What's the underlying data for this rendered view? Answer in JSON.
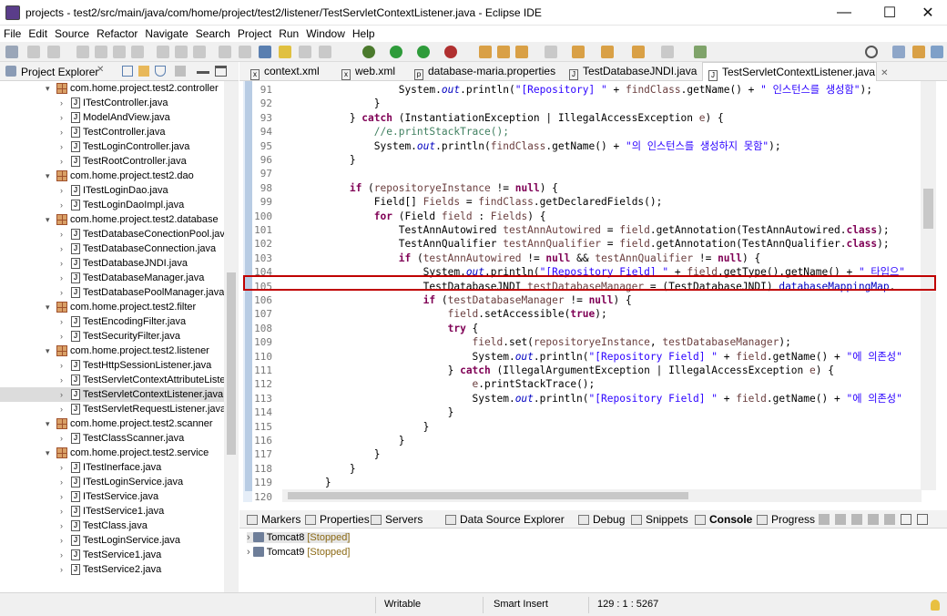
{
  "window": {
    "title": "projects - test2/src/main/java/com/home/project/test2/listener/TestServletContextListener.java - Eclipse IDE",
    "minimize": "—",
    "maximize": "☐",
    "close": "✕"
  },
  "menu": [
    "File",
    "Edit",
    "Source",
    "Refactor",
    "Navigate",
    "Search",
    "Project",
    "Run",
    "Window",
    "Help"
  ],
  "project_explorer": {
    "title": "Project Explorer",
    "items": [
      {
        "type": "pkg",
        "label": "com.home.project.test2.controller"
      },
      {
        "type": "file",
        "label": "ITestController.java"
      },
      {
        "type": "file",
        "label": "ModelAndView.java"
      },
      {
        "type": "file",
        "label": "TestController.java"
      },
      {
        "type": "file",
        "label": "TestLoginController.java"
      },
      {
        "type": "file",
        "label": "TestRootController.java"
      },
      {
        "type": "pkg",
        "label": "com.home.project.test2.dao"
      },
      {
        "type": "file",
        "label": "ITestLoginDao.java"
      },
      {
        "type": "file",
        "label": "TestLoginDaoImpl.java"
      },
      {
        "type": "pkg",
        "label": "com.home.project.test2.database"
      },
      {
        "type": "file",
        "label": "TestDatabaseConectionPool.java"
      },
      {
        "type": "file",
        "label": "TestDatabaseConnection.java"
      },
      {
        "type": "file",
        "label": "TestDatabaseJNDI.java"
      },
      {
        "type": "file",
        "label": "TestDatabaseManager.java"
      },
      {
        "type": "file",
        "label": "TestDatabasePoolManager.java"
      },
      {
        "type": "pkg",
        "label": "com.home.project.test2.filter"
      },
      {
        "type": "file",
        "label": "TestEncodingFilter.java"
      },
      {
        "type": "file",
        "label": "TestSecurityFilter.java"
      },
      {
        "type": "pkg",
        "label": "com.home.project.test2.listener"
      },
      {
        "type": "file",
        "label": "TestHttpSessionListener.java"
      },
      {
        "type": "file",
        "label": "TestServletContextAttributeListe"
      },
      {
        "type": "file",
        "label": "TestServletContextListener.java",
        "selected": true
      },
      {
        "type": "file",
        "label": "TestServletRequestListener.java"
      },
      {
        "type": "pkg",
        "label": "com.home.project.test2.scanner"
      },
      {
        "type": "file",
        "label": "TestClassScanner.java"
      },
      {
        "type": "pkg",
        "label": "com.home.project.test2.service"
      },
      {
        "type": "file",
        "label": "ITestInerface.java"
      },
      {
        "type": "file",
        "label": "ITestLoginService.java"
      },
      {
        "type": "file",
        "label": "ITestService.java"
      },
      {
        "type": "file",
        "label": "ITestService1.java"
      },
      {
        "type": "file",
        "label": "TestClass.java"
      },
      {
        "type": "file",
        "label": "TestLoginService.java"
      },
      {
        "type": "file",
        "label": "TestService1.java"
      },
      {
        "type": "file",
        "label": "TestService2.java"
      }
    ]
  },
  "editor_tabs": [
    {
      "label": "context.xml",
      "icon": "x"
    },
    {
      "label": "web.xml",
      "icon": "x"
    },
    {
      "label": "database-maria.properties",
      "icon": "p"
    },
    {
      "label": "TestDatabaseJNDI.java",
      "icon": "J"
    },
    {
      "label": "TestServletContextListener.java",
      "icon": "J",
      "active": true
    }
  ],
  "code_lines": [
    {
      "n": "91",
      "html": "                    System.<span class=\"fd\">out</span>.println(<span class=\"st\">\"[Repository] \"</span> + <span class=\"vr\">findClass</span>.getName() + <span class=\"st\">\" 인스턴스를 생성함\"</span>);"
    },
    {
      "n": "92",
      "html": "                }"
    },
    {
      "n": "93",
      "html": "            } <span class=\"kw\">catch</span> (InstantiationException | IllegalAccessException <span class=\"vr\">e</span>) {"
    },
    {
      "n": "94",
      "html": "                <span class=\"cm\">//e.printStackTrace();</span>"
    },
    {
      "n": "95",
      "html": "                System.<span class=\"fd\">out</span>.println(<span class=\"vr\">findClass</span>.getName() + <span class=\"st\">\"의 인스턴스를 생성하지 못함\"</span>);"
    },
    {
      "n": "96",
      "html": "            }"
    },
    {
      "n": "97",
      "html": ""
    },
    {
      "n": "98",
      "html": "            <span class=\"kw\">if</span> (<span class=\"vr\">repositoryeInstance</span> != <span class=\"kw\">null</span>) {"
    },
    {
      "n": "99",
      "html": "                Field[] <span class=\"vr\">Fields</span> = <span class=\"vr\">findClass</span>.getDeclaredFields();"
    },
    {
      "n": "100",
      "html": "                <span class=\"kw\">for</span> (Field <span class=\"vr\">field</span> : <span class=\"vr\">Fields</span>) {"
    },
    {
      "n": "101",
      "html": "                    TestAnnAutowired <span class=\"vr\">testAnnAutowired</span> = <span class=\"vr\">field</span>.getAnnotation(TestAnnAutowired.<span class=\"kw\">class</span>);"
    },
    {
      "n": "102",
      "html": "                    TestAnnQualifier <span class=\"vr\">testAnnQualifier</span> = <span class=\"vr\">field</span>.getAnnotation(TestAnnQualifier.<span class=\"kw\">class</span>);"
    },
    {
      "n": "103",
      "html": "                    <span class=\"kw\">if</span> (<span class=\"vr\">testAnnAutowired</span> != <span class=\"kw\">null</span> &amp;&amp; <span class=\"vr\">testAnnQualifier</span> != <span class=\"kw\">null</span>) {"
    },
    {
      "n": "104",
      "html": "                        System.<span class=\"fd\">out</span>.println(<span class=\"st\">\"[Repository Field] \"</span> + <span class=\"vr\">field</span>.getType().getName() + <span class=\"st\">\" 타입으\"</span>"
    },
    {
      "n": "105",
      "html": "                        TestDatabaseJNDI <span class=\"vr\">testDatabaseManager</span> = (TestDatabaseJNDI) <span class=\"vf\">databaseMappingMap</span>."
    },
    {
      "n": "106",
      "html": "                        <span class=\"kw\">if</span> (<span class=\"vr\">testDatabaseManager</span> != <span class=\"kw\">null</span>) {"
    },
    {
      "n": "107",
      "html": "                            <span class=\"vr\">field</span>.setAccessible(<span class=\"kw\">true</span>);"
    },
    {
      "n": "108",
      "html": "                            <span class=\"kw\">try</span> {"
    },
    {
      "n": "109",
      "html": "                                <span class=\"vr\">field</span>.set(<span class=\"vr\">repositoryeInstance</span>, <span class=\"vr\">testDatabaseManager</span>);"
    },
    {
      "n": "110",
      "html": "                                System.<span class=\"fd\">out</span>.println(<span class=\"st\">\"[Repository Field] \"</span> + <span class=\"vr\">field</span>.getName() + <span class=\"st\">\"에 의존성\"</span>"
    },
    {
      "n": "111",
      "html": "                            } <span class=\"kw\">catch</span> (IllegalArgumentException | IllegalAccessException <span class=\"vr\">e</span>) {"
    },
    {
      "n": "112",
      "html": "                                <span class=\"vr\">e</span>.printStackTrace();"
    },
    {
      "n": "113",
      "html": "                                System.<span class=\"fd\">out</span>.println(<span class=\"st\">\"[Repository Field] \"</span> + <span class=\"vr\">field</span>.getName() + <span class=\"st\">\"에 의존성\"</span>"
    },
    {
      "n": "114",
      "html": "                            }"
    },
    {
      "n": "115",
      "html": "                        }"
    },
    {
      "n": "116",
      "html": "                    }"
    },
    {
      "n": "117",
      "html": "                }"
    },
    {
      "n": "118",
      "html": "            }"
    },
    {
      "n": "119",
      "html": "        }"
    },
    {
      "n": "120",
      "html": "    }"
    }
  ],
  "bottom_tabs": [
    {
      "label": "Markers"
    },
    {
      "label": "Properties"
    },
    {
      "label": "Servers"
    },
    {
      "label": "Data Source Explorer"
    },
    {
      "label": "Debug"
    },
    {
      "label": "Snippets"
    },
    {
      "label": "Console",
      "bold": true
    },
    {
      "label": "Progress"
    }
  ],
  "servers": [
    {
      "name": "Tomcat8",
      "state": "[Stopped]"
    },
    {
      "name": "Tomcat9",
      "state": "[Stopped]"
    }
  ],
  "status": {
    "mode": "Writable",
    "insert": "Smart Insert",
    "position": "129 : 1 : 5267"
  }
}
